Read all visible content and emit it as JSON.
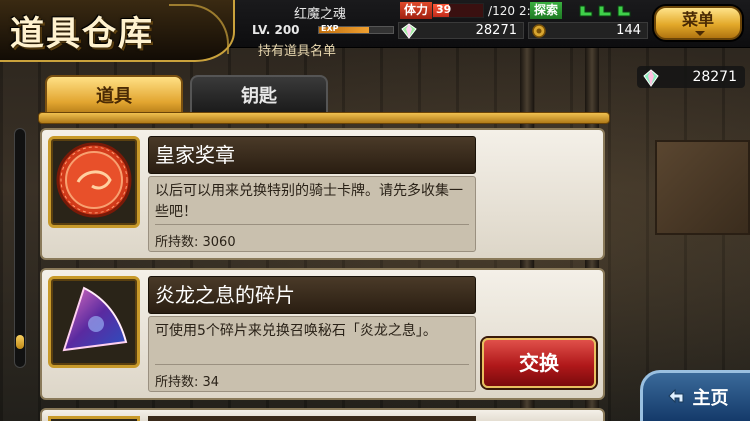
{
  "header": {
    "title": "道具仓库",
    "player_name": "红魔之魂",
    "level": "LV. 200",
    "exp_label": "EXP",
    "exp_progress": 0.68,
    "stamina_label": "体力",
    "stamina_value": "39",
    "stamina_max": "120",
    "stamina_progress": 0.325,
    "stamina_timer": "2:01",
    "explore_label": "探索",
    "gems": "28271",
    "coins": "144",
    "subtitle": "持有道具名单",
    "menu_label": "菜单"
  },
  "gem_total": "28271",
  "tabs": [
    {
      "label": "道具",
      "active": true
    },
    {
      "label": "钥匙",
      "active": false
    }
  ],
  "items": [
    {
      "name": "皇家奖章",
      "description": "以后可以用来兑换特别的骑士卡牌。请先多收集一些吧！",
      "count": "所持数: 3060"
    },
    {
      "name": "炎龙之息的碎片",
      "description": "可使用5个碎片来兑换召唤秘石「炎龙之息」。",
      "count": "所持数: 34",
      "action_label": "交换"
    }
  ],
  "scroll_position": 0.92,
  "home_label": "主页",
  "colors": {
    "accent_gold": "#e3a92a",
    "exchange_red": "#b0181a",
    "home_blue": "#143a6a"
  }
}
